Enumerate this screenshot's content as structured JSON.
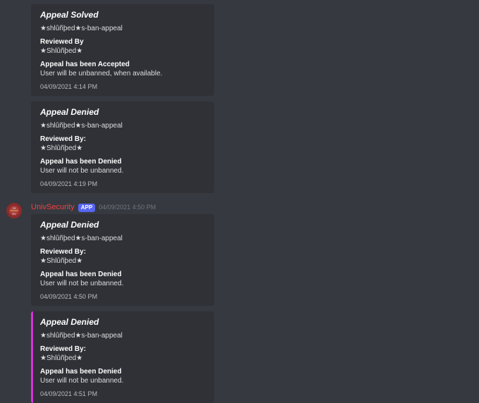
{
  "author": {
    "name": "UnivSecurity",
    "badge": "APP",
    "timestamp": "04/09/2021 4:50 PM"
  },
  "embeds": [
    {
      "bar_color": "#2f3136",
      "title": "Appeal Solved",
      "desc": "★shlûñþed★s-ban-appeal",
      "f1_name": "Reviewed By",
      "f1_value": "★Shlûñþed★",
      "f2_name": "Appeal has been Accepted",
      "f2_value": "User will be unbanned, when available.",
      "footer": "04/09/2021 4:14 PM"
    },
    {
      "bar_color": "#2f3136",
      "title": "Appeal Denied",
      "desc": "★shlûñþed★s-ban-appeal",
      "f1_name": "Reviewed By:",
      "f1_value": "★Shlûñþed★",
      "f2_name": "Appeal has been Denied",
      "f2_value": "User will not be unbanned.",
      "footer": "04/09/2021 4:19 PM"
    },
    {
      "bar_color": "#2f3136",
      "title": "Appeal Denied",
      "desc": "★shlûñþed★s-ban-appeal",
      "f1_name": "Reviewed By:",
      "f1_value": "★Shlûñþed★",
      "f2_name": "Appeal has been Denied",
      "f2_value": "User will not be unbanned.",
      "footer": "04/09/2021 4:50 PM"
    },
    {
      "bar_color": "#d932d9",
      "title": "Appeal Denied",
      "desc": "★shlûñþed★s-ban-appeal",
      "f1_name": "Reviewed By:",
      "f1_value": "★Shlûñþed★",
      "f2_name": "Appeal has been Denied",
      "f2_value": "User will not be unbanned.",
      "footer": "04/09/2021 4:51 PM"
    }
  ]
}
